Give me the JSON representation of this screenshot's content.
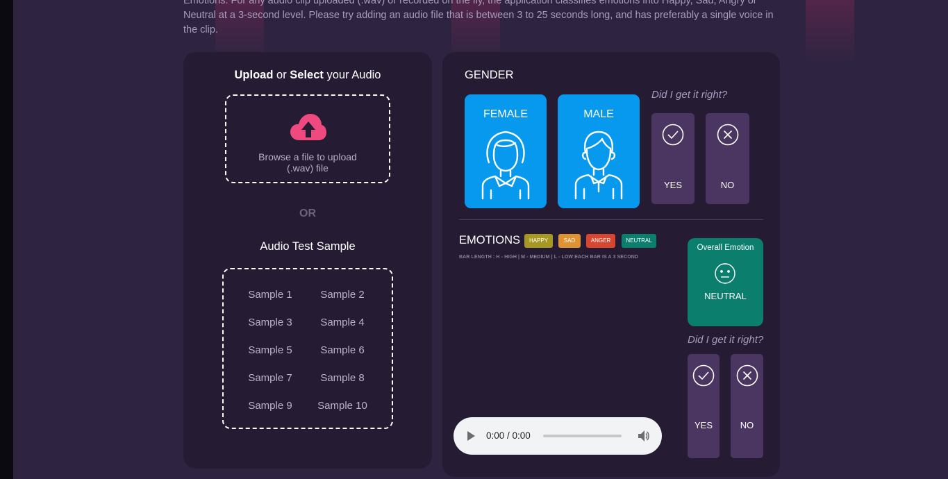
{
  "intro": {
    "text": "Emotions. For any audio clip uploaded (.wav) or recorded on the fly, the application classifies emotions into Happy, Sad, Angry or Neutral at a 3-second level. Please try adding an audio file that is between 3 to 25 seconds long, and has preferably a single voice in the clip."
  },
  "upload": {
    "title_upload": "Upload",
    "title_or": " or ",
    "title_select": "Select",
    "title_rest": " your Audio",
    "browse_text_line1": "Browse a file to upload",
    "browse_text_line2": "(.wav) file",
    "icon": "cloud-upload-icon",
    "icon_color": "#ef4a7f"
  },
  "or_label": "OR",
  "samples": {
    "title": "Audio Test Sample",
    "items": [
      "Sample 1",
      "Sample 2",
      "Sample 3",
      "Sample 4",
      "Sample 5",
      "Sample 6",
      "Sample 7",
      "Sample 8",
      "Sample 9",
      "Sample 10"
    ]
  },
  "gender": {
    "label": "GENDER",
    "female_label": "FEMALE",
    "male_label": "MALE",
    "card_color": "#0799ee",
    "question": "Did I get it right?",
    "yes_label": "YES",
    "no_label": "NO"
  },
  "emotions": {
    "label": "EMOTIONS",
    "legend": [
      {
        "label": "HAPPY",
        "color": "#a79723"
      },
      {
        "label": "SAD",
        "color": "#e09332"
      },
      {
        "label": "ANGER",
        "color": "#d9462f"
      },
      {
        "label": "NEUTRAL",
        "color": "#0b7e6e"
      }
    ],
    "bar_note": "BAR LENGTH : H - HIGH | M - MEDIUM | L - LOW EACH BAR IS A 3 SECOND",
    "overall_title": "Overall Emotion",
    "overall_value": "NEUTRAL",
    "overall_icon": "neutral-face-icon",
    "question": "Did I get it right?",
    "yes_label": "YES",
    "no_label": "NO"
  },
  "audio_player": {
    "time": "0:00 / 0:00"
  },
  "colors": {
    "background": "#2e2441",
    "panel": "#251c33",
    "vote_button": "#4a3660"
  }
}
